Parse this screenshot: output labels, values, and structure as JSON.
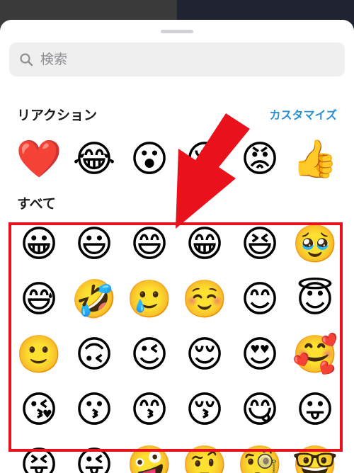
{
  "search": {
    "placeholder": "検索"
  },
  "reactions": {
    "title": "リアクション",
    "customize_label": "カスタマイズ",
    "emojis": [
      "❤️",
      "😂",
      "😮",
      "😢",
      "😡",
      "👍"
    ]
  },
  "all": {
    "title": "すべて",
    "emojis": [
      "😀",
      "😃",
      "😄",
      "😁",
      "😆",
      "🥹",
      "😅",
      "🤣",
      "🥲",
      "☺️",
      "😊",
      "😇",
      "🙂",
      "🙃",
      "😉",
      "😌",
      "😍",
      "🥰",
      "😘",
      "😗",
      "😙",
      "😚",
      "😋",
      "😛",
      "😝",
      "😜",
      "🤪",
      "🤨",
      "🧐",
      "🤓"
    ]
  },
  "colors": {
    "highlight": "#e8111c",
    "accent": "#2a8fd1"
  }
}
